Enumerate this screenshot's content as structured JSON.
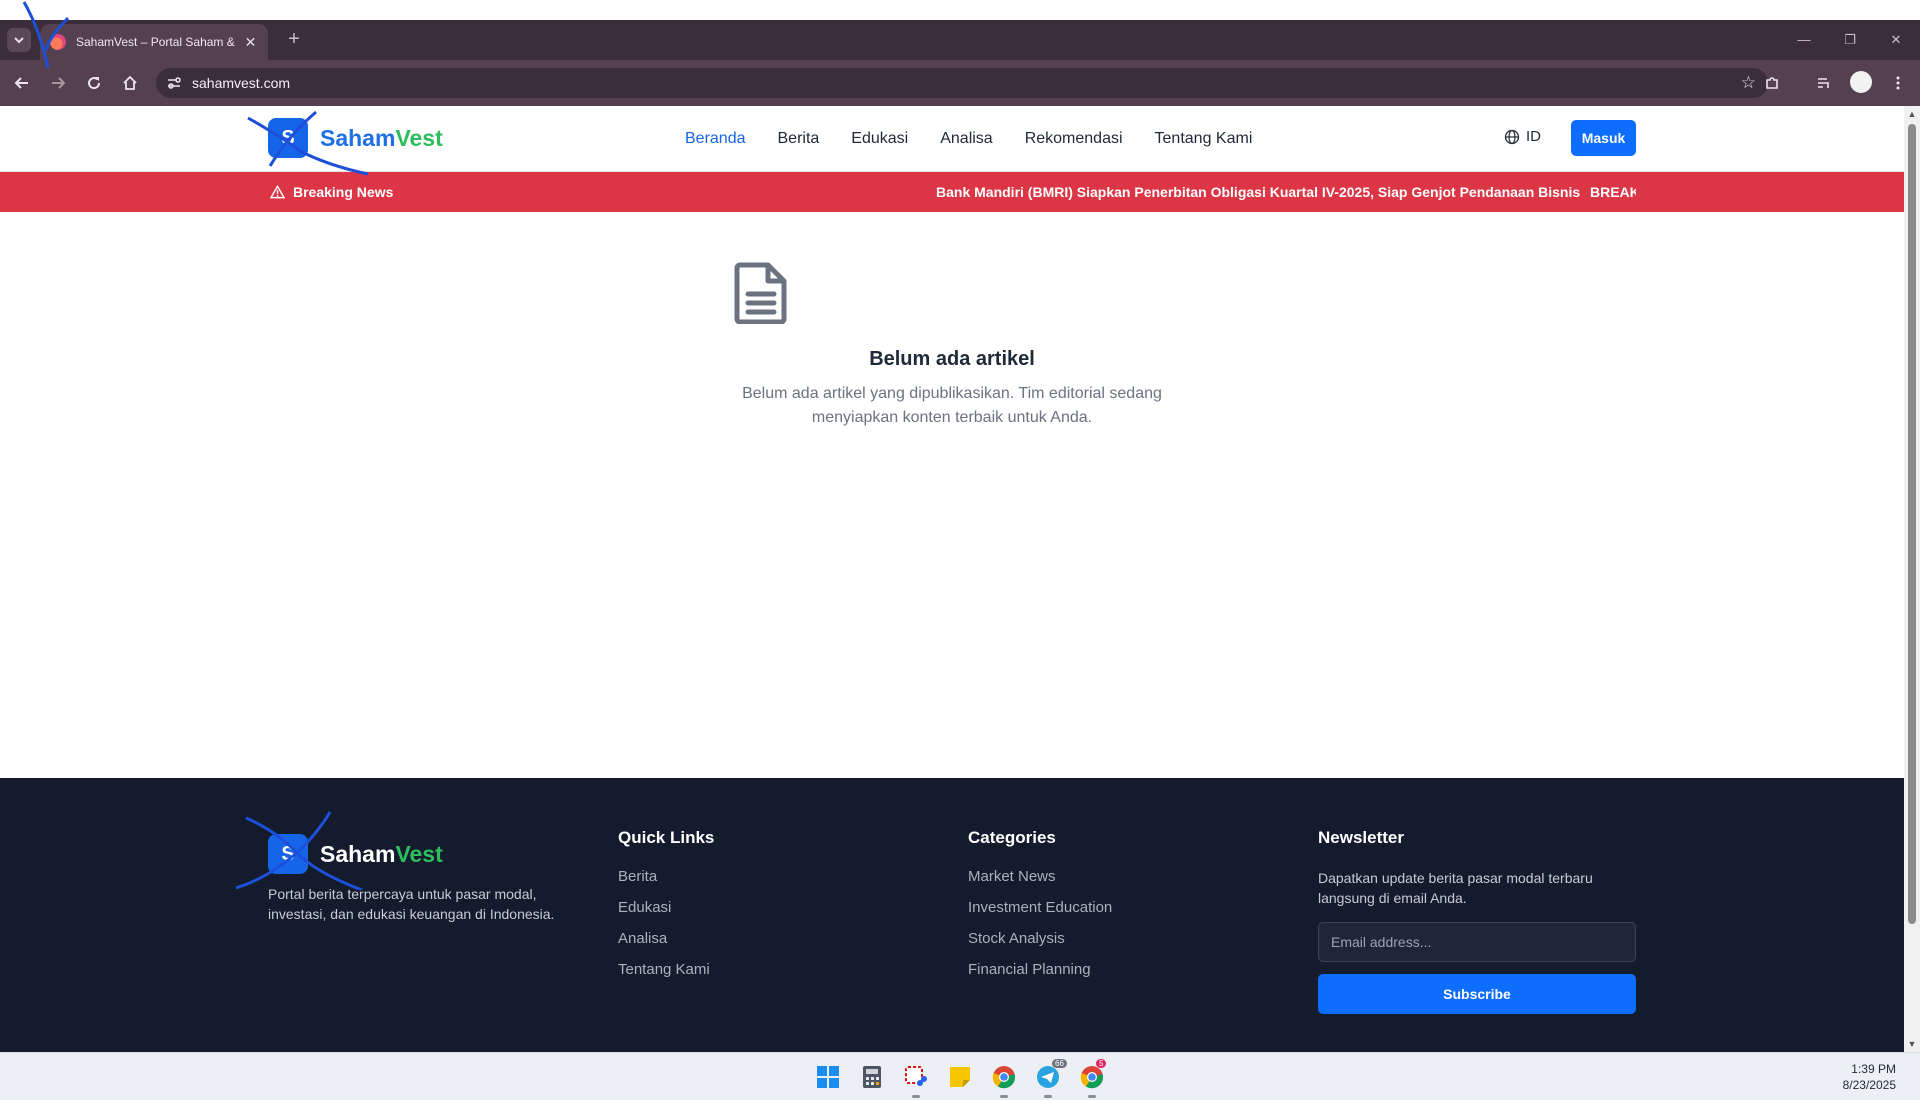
{
  "browser": {
    "tab_title": "SahamVest – Portal Saham & Edukasi",
    "url": "sahamvest.com"
  },
  "site": {
    "logo_letter": "S",
    "logo_part1": "Saham",
    "logo_part2": "Vest",
    "nav": [
      "Beranda",
      "Berita",
      "Edukasi",
      "Analisa",
      "Rekomendasi",
      "Tentang Kami"
    ],
    "lang": "ID",
    "login_label": "Masuk",
    "breaking_label": "Breaking News",
    "breaking_ticker": "Bank Mandiri (BMRI) Siapkan Penerbitan Obligasi Kuartal IV-2025, Siap Genjot Pendanaan Bisnis",
    "breaking_ticker_next": "BREAKI",
    "empty_title": "Belum ada artikel",
    "empty_desc": "Belum ada artikel yang dipublikasikan. Tim editorial sedang menyiapkan konten terbaik untuk Anda."
  },
  "footer": {
    "about": "Portal berita terpercaya untuk pasar modal, investasi, dan edukasi keuangan di Indonesia.",
    "quick_links_title": "Quick Links",
    "quick_links": [
      "Berita",
      "Edukasi",
      "Analisa",
      "Tentang Kami"
    ],
    "categories_title": "Categories",
    "categories": [
      "Market News",
      "Investment Education",
      "Stock Analysis",
      "Financial Planning"
    ],
    "newsletter_title": "Newsletter",
    "newsletter_text": "Dapatkan update berita pasar modal terbaru langsung di email Anda.",
    "email_placeholder": "Email address...",
    "subscribe_label": "Subscribe"
  },
  "taskbar": {
    "time": "1:39 PM",
    "date": "8/23/2025",
    "telegram_badge": "66",
    "chrome_badge": "5"
  },
  "colors": {
    "brand_blue": "#1565e8",
    "brand_green": "#2dbd5d",
    "breaking_red": "#dc3545",
    "footer_bg": "#131b2d"
  }
}
